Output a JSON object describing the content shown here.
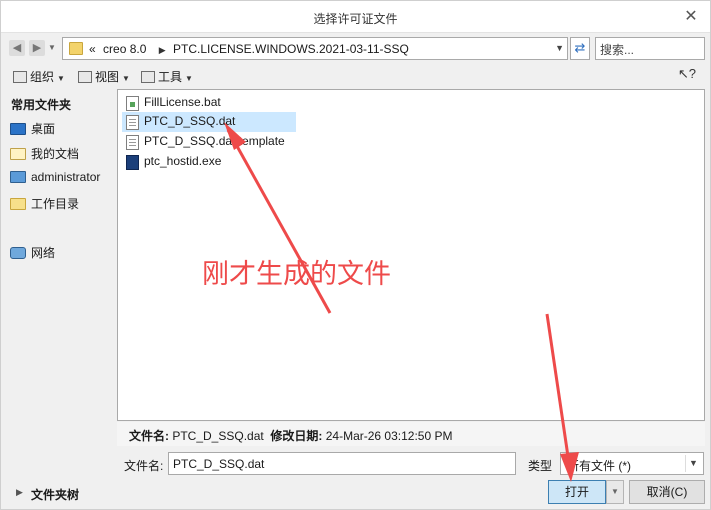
{
  "window": {
    "title": "选择许可证文件"
  },
  "address_bar": {
    "crumbs": [
      "creo 8.0",
      "PTC.LICENSE.WINDOWS.2021-03-11-SSQ"
    ],
    "overflow": "«",
    "search_placeholder": "搜索..."
  },
  "toolbar": {
    "organize_label": "组织",
    "view_label": "视图",
    "tools_label": "工具"
  },
  "sidebar": {
    "heading": "常用文件夹",
    "items": [
      {
        "label": "桌面",
        "icon": "desktop-icon"
      },
      {
        "label": "我的文档",
        "icon": "documents-icon"
      },
      {
        "label": "administrator",
        "icon": "computer-icon"
      },
      {
        "label": "工作目录",
        "icon": "working-directory-icon"
      },
      {
        "label": "网络",
        "icon": "network-icon"
      }
    ],
    "tree_label": "文件夹树"
  },
  "files": [
    {
      "name": "FillLicense.bat",
      "type": "bat",
      "selected": false
    },
    {
      "name": "PTC_D_SSQ.dat",
      "type": "dat",
      "selected": true
    },
    {
      "name": "PTC_D_SSQ.dat.template",
      "type": "dat",
      "selected": false
    },
    {
      "name": "ptc_hostid.exe",
      "type": "exe",
      "selected": false
    }
  ],
  "details": {
    "name_label": "文件名:",
    "name_value": "PTC_D_SSQ.dat",
    "modified_label": "修改日期:",
    "modified_value": "24-Mar-26 03:12:50 PM"
  },
  "form": {
    "filename_label": "文件名:",
    "filename_value": "PTC_D_SSQ.dat",
    "type_label": "类型",
    "type_value": "所有文件 (*)"
  },
  "buttons": {
    "open_label": "打开",
    "cancel_label": "取消(C)"
  },
  "annotation": {
    "text": "刚才生成的文件",
    "color": "#ee4a4a"
  },
  "colors": {
    "selection": "#cce8ff",
    "open_button": "#cde6f7"
  }
}
